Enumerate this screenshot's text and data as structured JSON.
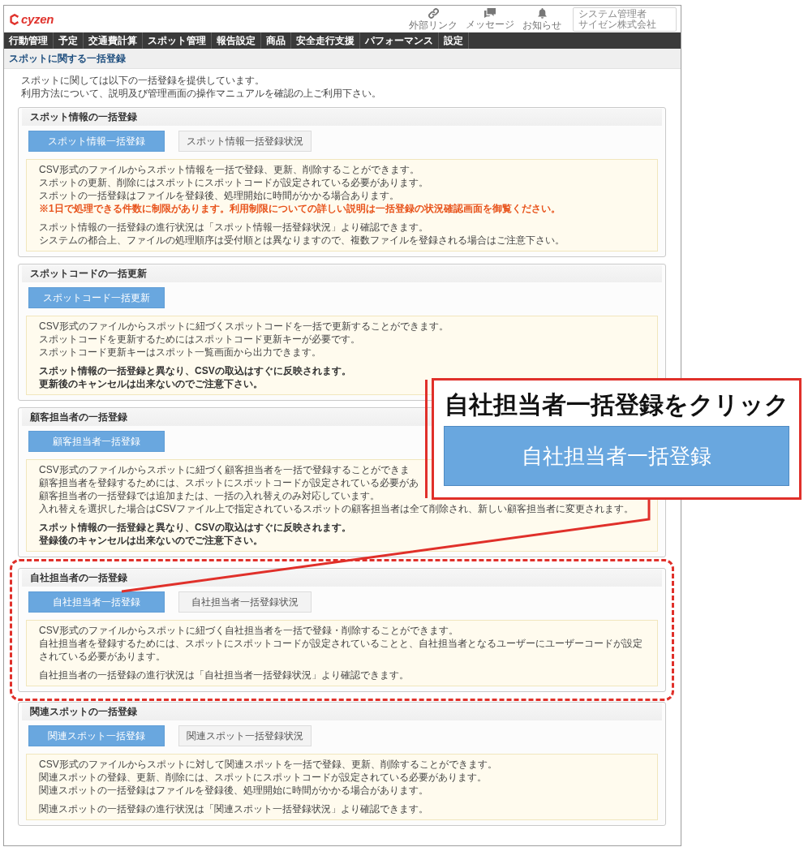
{
  "header": {
    "logo": "cyzen",
    "links": [
      {
        "kind": "link",
        "label": "外部リンク"
      },
      {
        "kind": "messages",
        "label": "メッセージ"
      },
      {
        "kind": "notifications",
        "label": "お知らせ"
      }
    ],
    "user": {
      "name": "システム管理者",
      "company": "サイゼン株式会社"
    }
  },
  "nav": [
    "行動管理",
    "予定",
    "交通費計算",
    "スポット管理",
    "報告設定",
    "商品",
    "安全走行支援",
    "パフォーマンス",
    "設定"
  ],
  "page_title": "スポットに関する一括登録",
  "intro": [
    "スポットに関しては以下の一括登録を提供しています。",
    "利用方法について、説明及び管理画面の操作マニュアルを確認の上ご利用下さい。"
  ],
  "sections": [
    {
      "title": "スポット情報の一括登録",
      "highlighted": false,
      "buttons": [
        {
          "kind": "primary",
          "label": "スポット情報一括登録"
        },
        {
          "kind": "secondary",
          "label": "スポット情報一括登録状況"
        }
      ],
      "notes": [
        [
          {
            "kind": "plain",
            "text": "CSV形式のファイルからスポット情報を一括で登録、更新、削除することができます。"
          },
          {
            "kind": "plain",
            "text": "スポットの更新、削除にはスポットにスポットコードが設定されている必要があります。"
          },
          {
            "kind": "plain",
            "text": "スポットの一括登録はファイルを登録後、処理開始に時間がかかる場合あります。"
          },
          {
            "kind": "warning",
            "text": "※1日で処理できる件数に制限があります。利用制限についての詳しい説明は一括登録の状況確認画面を御覧ください。"
          }
        ],
        [
          {
            "kind": "plain",
            "text": "スポット情報の一括登録の進行状況は「スポット情報一括登録状況」より確認できます。"
          },
          {
            "kind": "plain",
            "text": "システムの都合上、ファイルの処理順序は受付順とは異なりますので、複数ファイルを登録される場合はご注意下さい。"
          }
        ]
      ]
    },
    {
      "title": "スポットコードの一括更新",
      "highlighted": false,
      "buttons": [
        {
          "kind": "primary",
          "label": "スポットコード一括更新"
        }
      ],
      "notes": [
        [
          {
            "kind": "plain",
            "text": "CSV形式のファイルからスポットに紐づくスポットコードを一括で更新することができます。"
          },
          {
            "kind": "plain",
            "text": "スポットコードを更新するためにはスポットコード更新キーが必要です。"
          },
          {
            "kind": "plain",
            "text": "スポットコード更新キーはスポット一覧画面から出力できます。"
          }
        ],
        [
          {
            "kind": "bold",
            "text": "スポット情報の一括登録と異なり、CSVの取込はすぐに反映されます。"
          },
          {
            "kind": "bold",
            "text": "更新後のキャンセルは出来ないのでご注意下さい。"
          }
        ]
      ]
    },
    {
      "title": "顧客担当者の一括登録",
      "highlighted": false,
      "buttons": [
        {
          "kind": "primary",
          "label": "顧客担当者一括登録"
        }
      ],
      "notes": [
        [
          {
            "kind": "plain",
            "text": "CSV形式のファイルからスポットに紐づく顧客担当者を一括で登録することができま"
          },
          {
            "kind": "plain",
            "text": "顧客担当者を登録するためには、スポットにスポットコードが設定されている必要があ"
          },
          {
            "kind": "plain",
            "text": "顧客担当者の一括登録では追加または、一括の入れ替えのみ対応しています。"
          },
          {
            "kind": "plain",
            "text": "入れ替えを選択した場合はCSVファイル上で指定されているスポットの顧客担当者は全て削除され、新しい顧客担当者に変更されます。"
          }
        ],
        [
          {
            "kind": "bold",
            "text": "スポット情報の一括登録と異なり、CSVの取込はすぐに反映されます。"
          },
          {
            "kind": "bold",
            "text": "登録後のキャンセルは出来ないのでご注意下さい。"
          }
        ]
      ]
    },
    {
      "title": "自社担当者の一括登録",
      "highlighted": true,
      "buttons": [
        {
          "kind": "primary",
          "label": "自社担当者一括登録"
        },
        {
          "kind": "secondary",
          "label": "自社担当者一括登録状況"
        }
      ],
      "notes": [
        [
          {
            "kind": "plain",
            "text": "CSV形式のファイルからスポットに紐づく自社担当者を一括で登録・削除することができます。"
          },
          {
            "kind": "plain",
            "text": "自社担当者を登録するためには、スポットにスポットコードが設定されていることと、自社担当者となるユーザーにユーザーコードが設定されている必要があります。"
          }
        ],
        [
          {
            "kind": "plain",
            "text": "自社担当者の一括登録の進行状況は「自社担当者一括登録状況」より確認できます。"
          }
        ]
      ]
    },
    {
      "title": "関連スポットの一括登録",
      "highlighted": false,
      "buttons": [
        {
          "kind": "primary",
          "label": "関連スポット一括登録"
        },
        {
          "kind": "secondary",
          "label": "関連スポット一括登録状況"
        }
      ],
      "notes": [
        [
          {
            "kind": "plain",
            "text": "CSV形式のファイルからスポットに対して関連スポットを一括で登録、更新、削除することができます。"
          },
          {
            "kind": "plain",
            "text": "関連スポットの登録、更新、削除には、スポットにスポットコードが設定されている必要があります。"
          },
          {
            "kind": "plain",
            "text": "関連スポットの一括登録はファイルを登録後、処理開始に時間がかかる場合があります。"
          }
        ],
        [
          {
            "kind": "plain",
            "text": "関連スポットの一括登録の進行状況は「関連スポット一括登録状況」より確認できます。"
          }
        ]
      ]
    }
  ],
  "callout": {
    "title": "自社担当者一括登録をクリック",
    "button": "自社担当者一括登録"
  }
}
